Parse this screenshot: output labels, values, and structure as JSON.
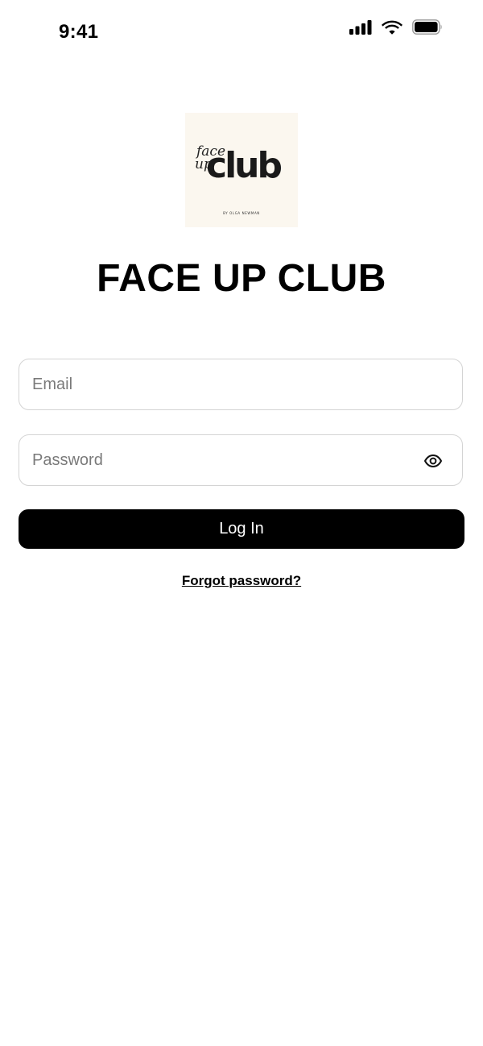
{
  "status_bar": {
    "time": "9:41",
    "icons": [
      "cellular-signal-icon",
      "wifi-icon",
      "battery-icon"
    ]
  },
  "logo": {
    "script_line1": "face",
    "script_line2": "up",
    "wordmark": "club",
    "byline": "BY OLGA NEWMAN"
  },
  "app_title": "FACE UP CLUB",
  "form": {
    "email": {
      "value": "",
      "placeholder": "Email"
    },
    "password": {
      "value": "",
      "placeholder": "Password",
      "toggle_icon": "eye-icon"
    },
    "login_label": "Log In",
    "forgot_label": "Forgot password?"
  },
  "colors": {
    "primary": "#000000",
    "background": "#ffffff",
    "logo_background": "#fbf7ef",
    "field_border": "#d4d4d4",
    "placeholder": "#7a7a7a"
  }
}
